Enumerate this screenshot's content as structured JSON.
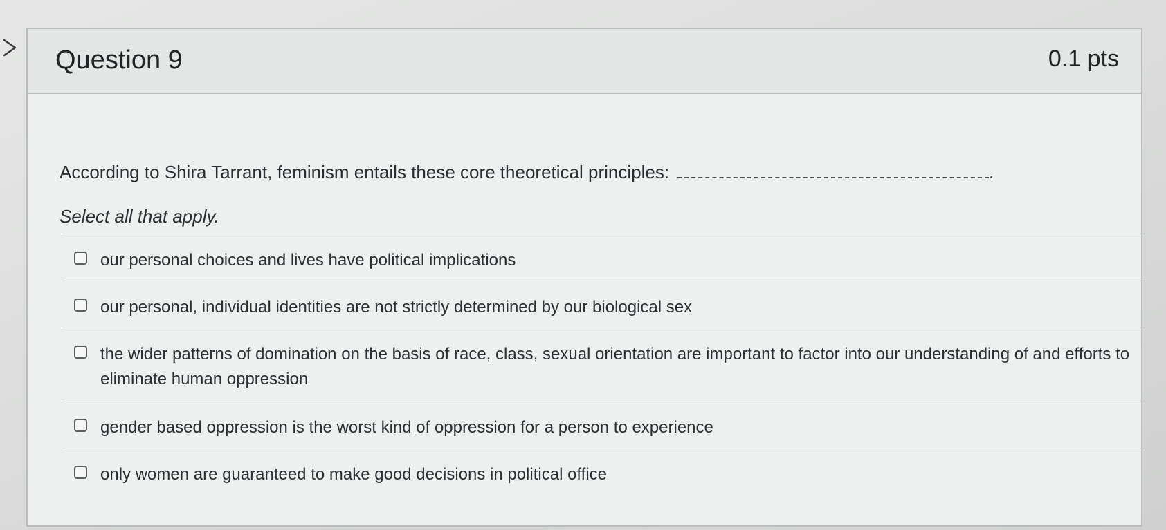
{
  "question": {
    "title": "Question 9",
    "points": "0.1 pts",
    "text": "According to Shira Tarrant, feminism entails these core theoretical principles:",
    "instruction": "Select all that apply."
  },
  "answers": [
    {
      "label": "our personal choices and lives have political implications",
      "checked": false
    },
    {
      "label": "our personal, individual identities are not strictly determined by our biological sex",
      "checked": false
    },
    {
      "label": "the wider patterns of domination on the basis of race, class, sexual orientation are important to factor into our understanding of and efforts to eliminate human oppression",
      "checked": false
    },
    {
      "label": "gender based oppression is the worst kind of oppression for a person to experience",
      "checked": false
    },
    {
      "label": "only women are guaranteed to make good decisions in political office",
      "checked": false
    }
  ],
  "icons": {
    "nav": "chevron-right-icon",
    "checkbox": "checkbox-unchecked-icon"
  },
  "colors": {
    "text": "#2a2f33",
    "card_border": "#b9bcbe",
    "header_bg": "#e4e5e5"
  }
}
